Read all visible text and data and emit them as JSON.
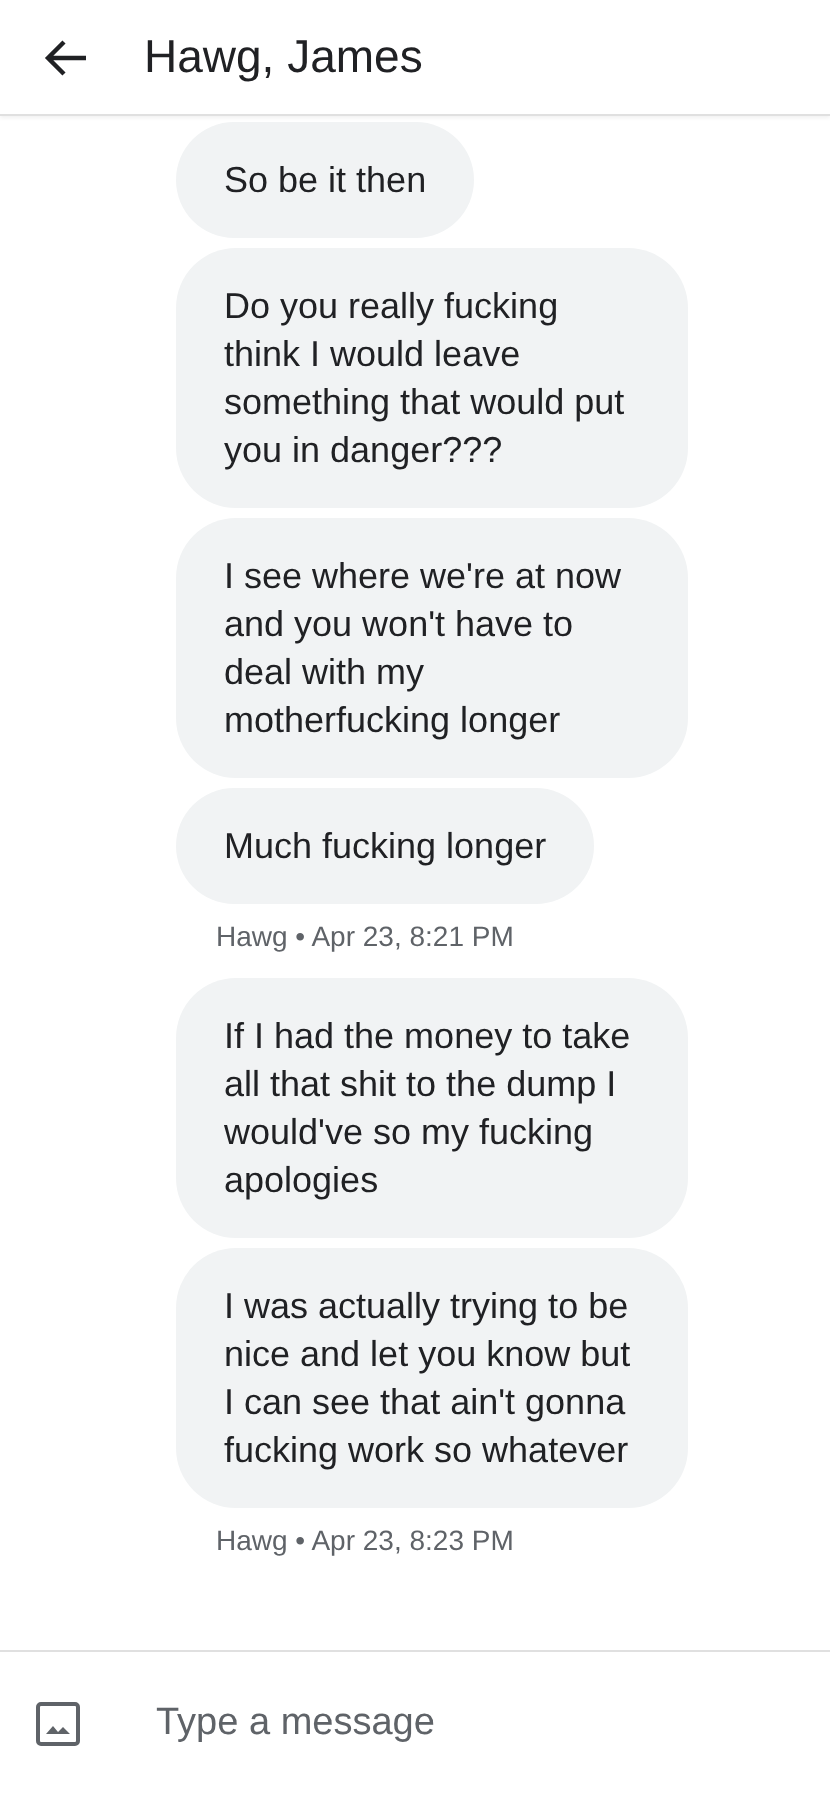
{
  "header": {
    "title": "Hawg, James"
  },
  "thread": [
    {
      "kind": "message",
      "text": "So be it then"
    },
    {
      "kind": "message",
      "text": "Do you really fucking think I would leave something that would put you in danger???"
    },
    {
      "kind": "message",
      "text": "I see where we're at now and you won't have to deal with my motherfucking longer"
    },
    {
      "kind": "message",
      "text": "Much fucking longer"
    },
    {
      "kind": "timestamp",
      "text": "Hawg • Apr 23, 8:21 PM"
    },
    {
      "kind": "message",
      "text": "If I had the money to take all that shit to the dump I would've so my fucking apologies"
    },
    {
      "kind": "message",
      "text": "I was actually trying to be nice and let you know but I can see that ain't gonna fucking work so whatever"
    },
    {
      "kind": "timestamp",
      "text": "Hawg • Apr 23, 8:23 PM"
    }
  ],
  "composer": {
    "placeholder": "Type a message"
  }
}
